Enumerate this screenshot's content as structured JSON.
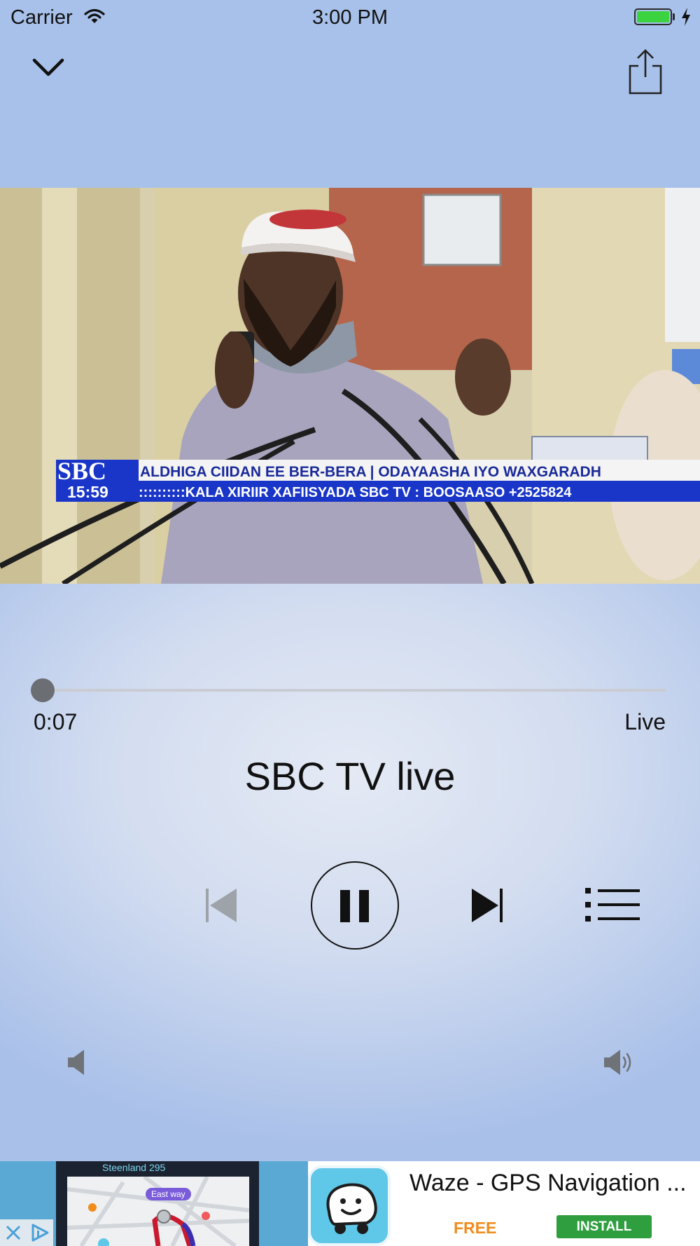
{
  "status_bar": {
    "carrier": "Carrier",
    "time": "3:00 PM",
    "wifi_icon": "wifi-icon",
    "battery_icon": "battery-charging-icon"
  },
  "header": {
    "collapse_icon": "chevron-down-icon",
    "share_icon": "share-icon"
  },
  "video": {
    "ticker_channel": "SBC",
    "ticker_time": "15:59",
    "ticker_line1": "ALDHIGA CIIDAN EE BER-BERA | ODAYAASHA IYO WAXGARADH",
    "ticker_line2": "::::::::::KALA XIRIIR XAFIISYADA SBC TV : BOOSAASO +2525824"
  },
  "player": {
    "elapsed": "0:07",
    "duration_label": "Live",
    "progress": 0.0,
    "title": "SBC TV live"
  },
  "controls": {
    "previous_icon": "previous-track-icon",
    "pause_icon": "pause-icon",
    "next_icon": "next-track-icon",
    "playlist_icon": "playlist-icon",
    "volume_low_icon": "volume-low-icon",
    "volume_high_icon": "volume-high-icon"
  },
  "ad": {
    "map_street": "Steenland 295",
    "map_bubble": "East way",
    "title": "Waze - GPS Navigation ...",
    "price": "FREE",
    "install_label": "INSTALL",
    "app_icon": "waze-icon",
    "close_icon": "close-icon",
    "adchoices_icon": "adchoices-icon"
  },
  "colors": {
    "header_bg": "#a8c1ea",
    "battery_green": "#3bd33f",
    "ticker_blue": "#1a36c8",
    "install_green": "#2e9e3e",
    "price_orange": "#f08c1e"
  }
}
